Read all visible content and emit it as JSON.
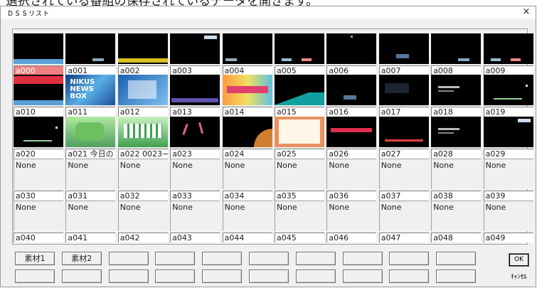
{
  "page_heading": "選択されている番組の保存されているデータを開きます。",
  "window": {
    "title": "ＤＳＳリスト",
    "close_glyph": "×"
  },
  "cells": [
    {
      "id": "a000",
      "caption": "a000",
      "thumb": "black-ticker",
      "selected": true
    },
    {
      "id": "a001",
      "caption": "a001",
      "thumb": "black-badge"
    },
    {
      "id": "a002",
      "caption": "a002",
      "thumb": "black-yellow"
    },
    {
      "id": "a003",
      "caption": "a003",
      "thumb": "black-topright"
    },
    {
      "id": "a004",
      "caption": "a004",
      "thumb": "black-bottomleft"
    },
    {
      "id": "a005",
      "caption": "a005",
      "thumb": "black-badge2"
    },
    {
      "id": "a006",
      "caption": "a006",
      "thumb": "black-dot"
    },
    {
      "id": "a007",
      "caption": "a007",
      "thumb": "black-center"
    },
    {
      "id": "a008",
      "caption": "a008",
      "thumb": "black-badge"
    },
    {
      "id": "a009",
      "caption": "a009",
      "thumb": "black-badge2"
    },
    {
      "id": "a010",
      "caption": "a010",
      "thumb": "black-red"
    },
    {
      "id": "a011",
      "caption": "a011",
      "thumb": "news",
      "thumb_text": "NIKUS NEWS BOX"
    },
    {
      "id": "a012",
      "caption": "a012",
      "thumb": "blue-panel"
    },
    {
      "id": "a013",
      "caption": "a013",
      "thumb": "black-purple"
    },
    {
      "id": "a014",
      "caption": "a014",
      "thumb": "colorful"
    },
    {
      "id": "a015",
      "caption": "a015",
      "thumb": "teal-diag"
    },
    {
      "id": "a016",
      "caption": "a016",
      "thumb": "black-center"
    },
    {
      "id": "a017",
      "caption": "a017",
      "thumb": "black-dark"
    },
    {
      "id": "a018",
      "caption": "a018",
      "thumb": "black-text"
    },
    {
      "id": "a019",
      "caption": "a019",
      "thumb": "black-dots"
    },
    {
      "id": "a020",
      "caption": "a020",
      "thumb": "black-dots"
    },
    {
      "id": "a021",
      "caption": "a021 今日の",
      "thumb": "green-map"
    },
    {
      "id": "a022",
      "caption": "a022 0023−",
      "thumb": "green-grid"
    },
    {
      "id": "a023",
      "caption": "a023",
      "thumb": "black-sticks"
    },
    {
      "id": "a024",
      "caption": "a024",
      "thumb": "black-orange"
    },
    {
      "id": "a025",
      "caption": "a025",
      "thumb": "orange-card"
    },
    {
      "id": "a026",
      "caption": "a026",
      "thumb": "black-redbar"
    },
    {
      "id": "a027",
      "caption": "a027",
      "thumb": "black-redtext"
    },
    {
      "id": "a028",
      "caption": "a028",
      "thumb": "black-text"
    },
    {
      "id": "a029",
      "caption": "a029",
      "thumb": "black-topright"
    },
    {
      "id": "a030",
      "caption": "a030",
      "thumb": "none",
      "thumb_text": "None"
    },
    {
      "id": "a031",
      "caption": "a031",
      "thumb": "none",
      "thumb_text": "None"
    },
    {
      "id": "a032",
      "caption": "a032",
      "thumb": "none",
      "thumb_text": "None"
    },
    {
      "id": "a033",
      "caption": "a033",
      "thumb": "none",
      "thumb_text": "None"
    },
    {
      "id": "a034",
      "caption": "a034",
      "thumb": "none",
      "thumb_text": "None"
    },
    {
      "id": "a035",
      "caption": "a035",
      "thumb": "none",
      "thumb_text": "None"
    },
    {
      "id": "a036",
      "caption": "a036",
      "thumb": "none",
      "thumb_text": "None"
    },
    {
      "id": "a037",
      "caption": "a037",
      "thumb": "none",
      "thumb_text": "None"
    },
    {
      "id": "a038",
      "caption": "a038",
      "thumb": "none",
      "thumb_text": "None"
    },
    {
      "id": "a039",
      "caption": "a039",
      "thumb": "none",
      "thumb_text": "None"
    },
    {
      "id": "a040",
      "caption": "a040",
      "thumb": "none",
      "thumb_text": "None"
    },
    {
      "id": "a041",
      "caption": "a041",
      "thumb": "none",
      "thumb_text": "None"
    },
    {
      "id": "a042",
      "caption": "a042",
      "thumb": "none",
      "thumb_text": "None"
    },
    {
      "id": "a043",
      "caption": "a043",
      "thumb": "none",
      "thumb_text": "None"
    },
    {
      "id": "a044",
      "caption": "a044",
      "thumb": "none",
      "thumb_text": "None"
    },
    {
      "id": "a045",
      "caption": "a045",
      "thumb": "none",
      "thumb_text": "None"
    },
    {
      "id": "a046",
      "caption": "a046",
      "thumb": "none",
      "thumb_text": "None"
    },
    {
      "id": "a047",
      "caption": "a047",
      "thumb": "none",
      "thumb_text": "None"
    },
    {
      "id": "a048",
      "caption": "a048",
      "thumb": "none",
      "thumb_text": "None"
    },
    {
      "id": "a049",
      "caption": "a049",
      "thumb": "none",
      "thumb_text": "None"
    }
  ],
  "material_buttons": [
    "素材1",
    "素材2",
    "",
    "",
    "",
    "",
    "",
    "",
    "",
    "",
    "",
    "",
    "",
    "",
    "",
    "",
    "",
    "",
    "",
    ""
  ],
  "ok_label": "OK",
  "cancel_label": "ｷｬﾝｾﾙ",
  "colors": {
    "selected_caption": "#f08080",
    "thumb_black": "#000000"
  }
}
